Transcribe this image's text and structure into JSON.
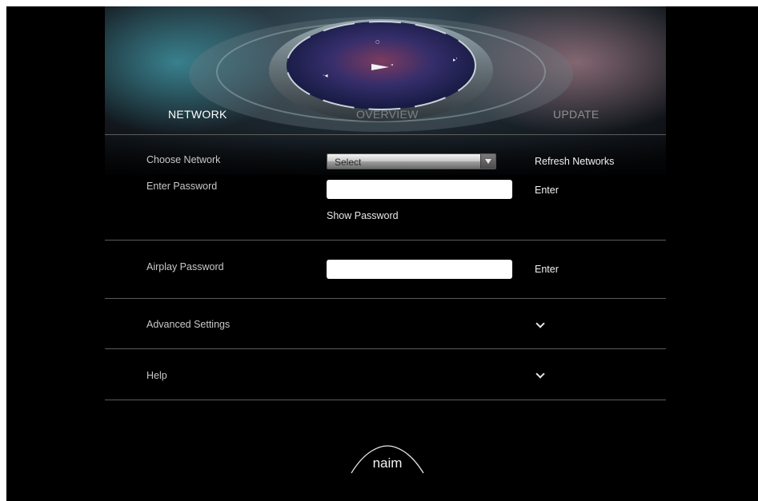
{
  "tabs": {
    "network": "NETWORK",
    "overview": "OVERVIEW",
    "update": "UPDATE"
  },
  "network": {
    "choose_label": "Choose Network",
    "select_value": "Select",
    "refresh_label": "Refresh Networks",
    "password_label": "Enter Password",
    "password_value": "",
    "enter_label": "Enter",
    "show_password_label": "Show Password"
  },
  "airplay": {
    "label": "Airplay Password",
    "password_value": "",
    "enter_label": "Enter"
  },
  "advanced": {
    "label": "Advanced Settings"
  },
  "help": {
    "label": "Help"
  },
  "brand": {
    "logo_text": "naim"
  },
  "icons": {
    "select_arrow": "dropdown-arrow-icon",
    "expand": "chevron-down-icon"
  },
  "colors": {
    "background": "#000000",
    "active_tab": "#ffffff",
    "inactive_tab": "#7a7a7a",
    "divider": "#5b5b5b"
  }
}
